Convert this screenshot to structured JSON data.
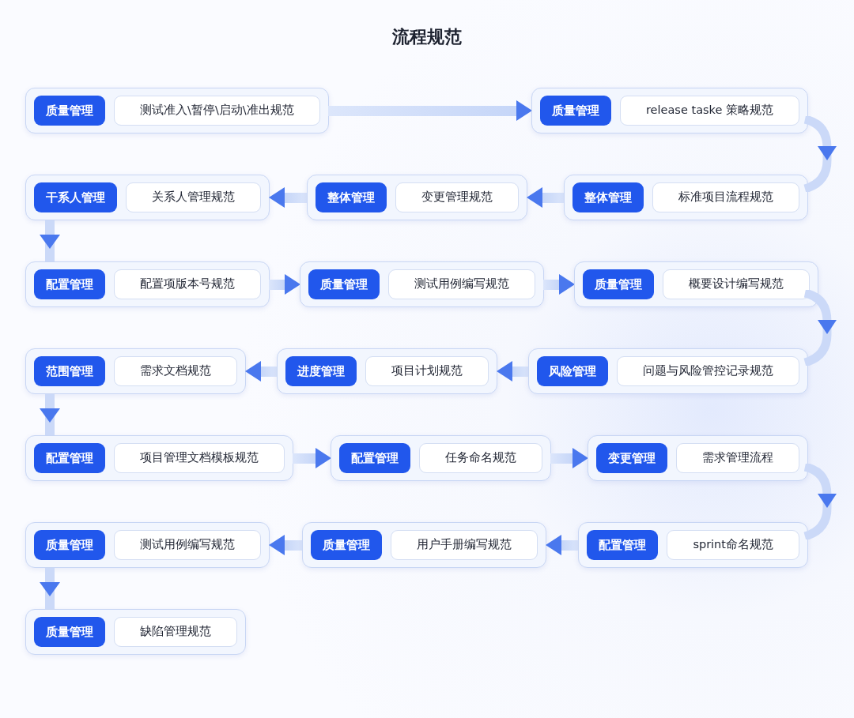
{
  "title": "流程规范",
  "rows": [
    {
      "kind": "forward",
      "nodes": [
        {
          "category": "质量管理",
          "name": "测试准入\\暂停\\启动\\准出规范"
        },
        {
          "category": "质量管理",
          "name": "release taske 策略规范"
        }
      ]
    },
    {
      "kind": "backward",
      "nodes": [
        {
          "category": "干系人管理",
          "name": "关系人管理规范"
        },
        {
          "category": "整体管理",
          "name": "变更管理规范"
        },
        {
          "category": "整体管理",
          "name": "标准项目流程规范"
        }
      ]
    },
    {
      "kind": "forward",
      "nodes": [
        {
          "category": "配置管理",
          "name": "配置项版本号规范"
        },
        {
          "category": "质量管理",
          "name": "测试用例编写规范"
        },
        {
          "category": "质量管理",
          "name": "概要设计编写规范"
        }
      ]
    },
    {
      "kind": "backward",
      "nodes": [
        {
          "category": "范围管理",
          "name": "需求文档规范"
        },
        {
          "category": "进度管理",
          "name": "项目计划规范"
        },
        {
          "category": "风险管理",
          "name": "问题与风险管控记录规范"
        }
      ]
    },
    {
      "kind": "forward",
      "nodes": [
        {
          "category": "配置管理",
          "name": "项目管理文档模板规范"
        },
        {
          "category": "配置管理",
          "name": "任务命名规范"
        },
        {
          "category": "变更管理",
          "name": "需求管理流程"
        }
      ]
    },
    {
      "kind": "backward",
      "nodes": [
        {
          "category": "质量管理",
          "name": "测试用例编写规范"
        },
        {
          "category": "质量管理",
          "name": "用户手册编写规范"
        },
        {
          "category": "配置管理",
          "name": "sprint命名规范"
        }
      ]
    },
    {
      "kind": "forward",
      "nodes": [
        {
          "category": "质量管理",
          "name": "缺陷管理规范"
        }
      ]
    }
  ]
}
